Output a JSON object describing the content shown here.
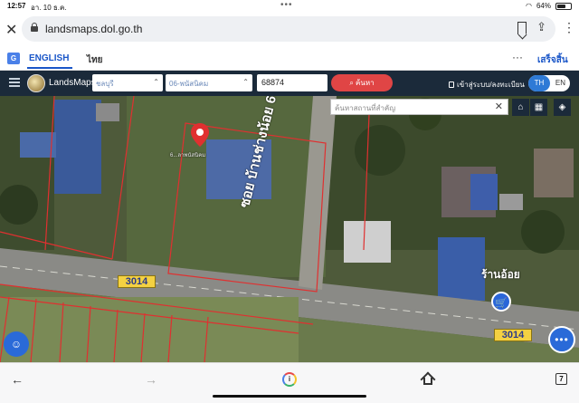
{
  "status_bar": {
    "time": "12:57",
    "date": "อา. 10 ธ.ค.",
    "battery_text": "64%",
    "battery_level": 0.64
  },
  "browser": {
    "url": "landsmaps.dol.go.th",
    "icons": [
      "close-icon",
      "lock-icon",
      "bookmark-icon",
      "share-icon",
      "more-icon"
    ]
  },
  "translate_bar": {
    "english_label": "ENGLISH",
    "thai_label": "ไทย",
    "done_label": "เสร็จสิ้น",
    "more_label": "···"
  },
  "app_header": {
    "title": "LandsMaps",
    "province": "ชลบุรี",
    "district": "06-พนัสนิคม",
    "parcel_number": "68874",
    "search_label": "ค้นหา",
    "login_label": "เข้าสู่ระบบ/ลงทะเบียน",
    "lang_th": "TH",
    "lang_en": "EN"
  },
  "map": {
    "place_search_placeholder": "ค้นหาสถานที่สำคัญ",
    "road_sign_1": "3014",
    "road_sign_2": "3014",
    "road_name": "ซอย บ้านช่างน้อย 6",
    "shop_label": "ร้านอ้อย",
    "parcel_label": "6...ลาพนัสนิคม",
    "colors": {
      "accent": "#2e7ad6",
      "search_button": "#e04545",
      "road_sign": "#f4d142",
      "parcel_line": "#e03030",
      "header_bg": "#1b2a3a"
    }
  },
  "bottom_toolbar": {
    "tab_count": "7"
  }
}
